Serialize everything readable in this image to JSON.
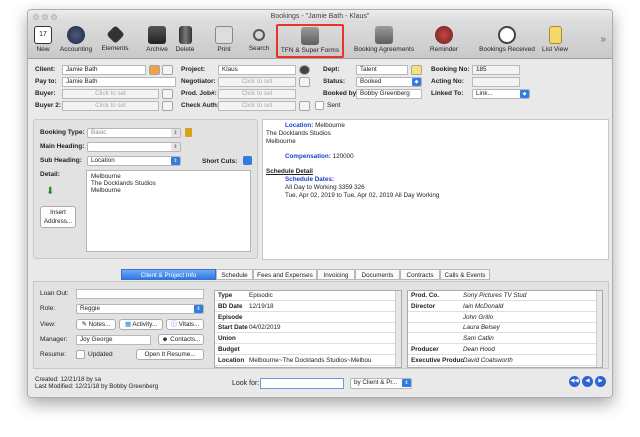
{
  "window": {
    "title": "Bookings - \"Jamie Bath - Klaus\""
  },
  "toolbar": {
    "items": [
      {
        "label": "New",
        "icon": "new-icon"
      },
      {
        "label": "Accounting",
        "icon": "accounting-icon"
      },
      {
        "label": "Elements",
        "icon": "elements-icon"
      },
      {
        "label": "Archive",
        "icon": "archive-icon"
      },
      {
        "label": "Delete",
        "icon": "trash-icon"
      },
      {
        "label": "Print",
        "icon": "print-icon"
      },
      {
        "label": "Search",
        "icon": "search-icon"
      },
      {
        "label": "TFN & Super Forms",
        "icon": "forms-icon"
      },
      {
        "label": "Booking Agreements",
        "icon": "agreements-icon"
      },
      {
        "label": "Reminder",
        "icon": "reminder-icon"
      },
      {
        "label": "Bookings Received",
        "icon": "clock-icon"
      },
      {
        "label": "List View",
        "icon": "list-view-icon"
      }
    ],
    "overflow": "»"
  },
  "header": {
    "client_label": "Client:",
    "client": "Jamie Bath",
    "payto_label": "Pay to:",
    "payto": "Jamie Bath",
    "buyer_label": "Buyer:",
    "buyer": "Click to set",
    "buyer2_label": "Buyer 2:",
    "buyer2": "Click to set",
    "project_label": "Project:",
    "project": "Klaus",
    "negotiator_label": "Negotiator:",
    "negotiator": "Click to set",
    "prodjob_label": "Prod. Job#:",
    "prodjob": "Click to set",
    "checkauth_label": "Check Auth:",
    "checkauth": "Click to set",
    "dept_label": "Dept:",
    "dept": "Talent",
    "status_label": "Status:",
    "status": "Booked",
    "bookedby_label": "Booked by:",
    "bookedby": "Bobby Greenberg",
    "sent_label": "Sent",
    "bookingno_label": "Booking No:",
    "bookingno": "185",
    "actingno_label": "Acting No:",
    "actingno": "",
    "linkedto_label": "Linked To:",
    "linkedto": "Link..."
  },
  "booking": {
    "type_label": "Booking Type:",
    "type": "Basic",
    "main_label": "Main Heading:",
    "main": "",
    "sub_label": "Sub Heading:",
    "sub": "Location",
    "shortcuts_label": "Short Cuts:",
    "detail_label": "Detail:",
    "detail_lines": [
      "Melbourne",
      "The Docklands Studios",
      "Melbourne"
    ],
    "insert_label": "Insert Address..."
  },
  "detail_text": {
    "location_key": "Location:",
    "location_val": " Melbourne",
    "line2": "The Docklands Studios",
    "line3": "Melbourne",
    "comp_key": "Compensation:",
    "comp_val": " 120000",
    "sched_title": "Schedule Detail",
    "sched_dates": "Schedule Dates:",
    "sched_line1": "All Day to Working   3359  326",
    "sched_line2": "Tue, Apr 02, 2019 to Tue, Apr 02, 2019  All Day  Working"
  },
  "tabs": [
    "Client & Project Info",
    "Schedule",
    "Fees and Expenses",
    "Invoicing",
    "Documents",
    "Contracts",
    "Calls & Events"
  ],
  "client_info": {
    "loanout_label": "Loan Out:",
    "loanout": "",
    "role_label": "Role:",
    "role": "Reggie",
    "view_label": "View:",
    "notes": "Notes...",
    "activity": "Activity...",
    "vitals": "Vitals...",
    "manager_label": "Manager:",
    "manager": "Joy George",
    "contacts": "Contacts...",
    "resume_label": "Resume:",
    "updated": "Updated",
    "openresume": "Open It Resume..."
  },
  "project_table": [
    {
      "k": "Type",
      "v": "Episodic"
    },
    {
      "k": "BD Date",
      "v": "12/19/18"
    },
    {
      "k": "Episode",
      "v": ""
    },
    {
      "k": "Start Date",
      "v": "04/02/2019"
    },
    {
      "k": "Union",
      "v": ""
    },
    {
      "k": "Budget",
      "v": ""
    },
    {
      "k": "Location",
      "v": "Melbourne~The Docklands Studios~Melbou"
    }
  ],
  "company_table": [
    {
      "k": "Prod. Co.",
      "v": "Sony Pictures TV Stud"
    },
    {
      "k": "Director",
      "v": "Iain McDonald"
    },
    {
      "k": "",
      "v": "John Grillo"
    },
    {
      "k": "",
      "v": "Laura Belsey"
    },
    {
      "k": "",
      "v": "Sam Catlin"
    },
    {
      "k": "Producer",
      "v": "Dean Hood"
    },
    {
      "k": "Executive Produc",
      "v": "David Coatsworth"
    }
  ],
  "footer": {
    "created": "Created: 12/21/18 by sa",
    "modified": "Last Modified: 12/21/18 by Bobby Greenberg",
    "lookfor_label": "Look for:",
    "lookfor": "",
    "by": "by Client & Pr..."
  },
  "colors": {
    "accent": "#2f7de1",
    "highlight": "#e8332a",
    "link_blue": "#1c3fcf"
  }
}
